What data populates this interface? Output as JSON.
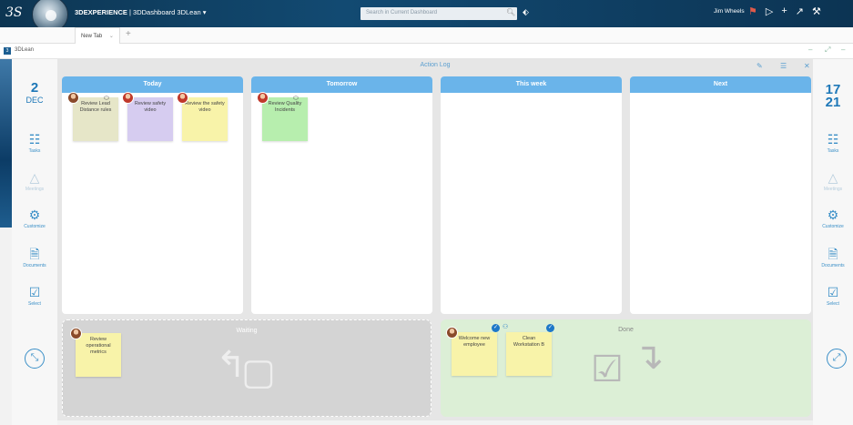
{
  "topbar": {
    "logo": "3S",
    "brand_bold": "3DEXPERIENCE",
    "brand_rest": " | 3DDashboard 3DLean ▾",
    "search_placeholder": "Search in Current Dashboard",
    "user": "Jim Wheels"
  },
  "tabs": [
    {
      "label": "New Tab"
    }
  ],
  "app": {
    "badge": "3",
    "name": "3DLean"
  },
  "left_panel": {
    "date_day": "2",
    "date_month": "DEC",
    "items": [
      {
        "label": "Tasks",
        "icon": "tasks-icon"
      },
      {
        "label": "Meetings",
        "icon": "meetings-icon"
      },
      {
        "label": "Customize",
        "icon": "customize-icon"
      },
      {
        "label": "Documents",
        "icon": "documents-icon"
      },
      {
        "label": "Select",
        "icon": "select-icon"
      }
    ]
  },
  "right_panel": {
    "week_top": "17",
    "week_bottom": "21",
    "items": [
      {
        "label": "Tasks",
        "icon": "tasks-icon"
      },
      {
        "label": "Meetings",
        "icon": "meetings-icon"
      },
      {
        "label": "Customize",
        "icon": "customize-icon"
      },
      {
        "label": "Documents",
        "icon": "documents-icon"
      },
      {
        "label": "Select",
        "icon": "select-icon"
      }
    ]
  },
  "board": {
    "title": "Action Log",
    "columns": [
      {
        "title": "Today"
      },
      {
        "title": "Tomorrow"
      },
      {
        "title": "This week"
      },
      {
        "title": "Next"
      }
    ],
    "today_notes": [
      {
        "text": "Review Lead Distance rules",
        "color": "beige"
      },
      {
        "text": "Review safety video",
        "color": "purple"
      },
      {
        "text": "Review the safety video",
        "color": "yellow"
      }
    ],
    "tomorrow_notes": [
      {
        "text": "Review Quality Incidents",
        "color": "green"
      }
    ],
    "waiting": {
      "title": "Waiting",
      "notes": [
        {
          "text": "Review operational metrics",
          "color": "yellow"
        }
      ]
    },
    "done": {
      "title": "Done",
      "notes": [
        {
          "text": "Welcome new employee",
          "color": "yellow"
        },
        {
          "text": "Clean Workstation B",
          "color": "yellow"
        }
      ]
    }
  },
  "colors": {
    "topbar": "#0f3f63",
    "column_header": "#6ab4ea",
    "accent": "#1e78b8",
    "done_zone": "#dcefd6",
    "waiting_zone": "#d4d4d4"
  }
}
